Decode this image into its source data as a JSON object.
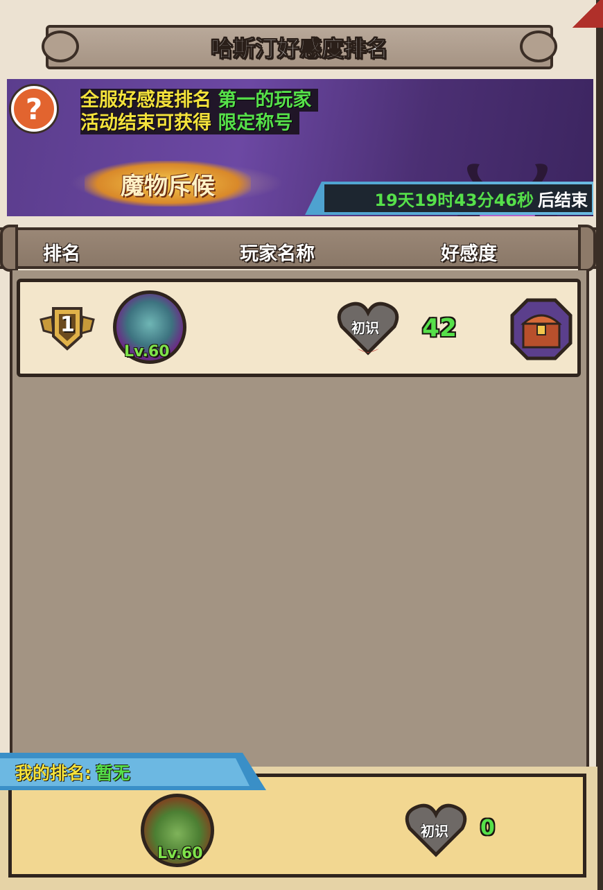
{
  "title": "哈斯汀好感度排名",
  "banner": {
    "help_icon": "question-mark",
    "line1_prefix": "全服好感度排名",
    "line1_highlight": "第一的玩家",
    "line2_prefix": "活动结束可获得",
    "line2_highlight": "限定称号",
    "event_logo": "魔物斥候",
    "countdown": "19天19时43分46秒",
    "countdown_suffix": "后结束"
  },
  "columns": {
    "rank": "排名",
    "player_name": "玩家名称",
    "favor": "好感度"
  },
  "rows": [
    {
      "rank": "1",
      "level": "Lv.60",
      "player_name": "",
      "relation": "初识",
      "favor": "42",
      "reward_icon": "treasure-chest"
    }
  ],
  "my_rank": {
    "label": "我的排名:",
    "value": "暂无",
    "level": "Lv.60",
    "relation": "初识",
    "favor": "0"
  },
  "colors": {
    "highlight_green": "#56e04a",
    "highlight_yellow": "#f4e23c",
    "panel_brown": "#a39483",
    "row_cream": "#f3e6cb",
    "my_panel": "#f2d791"
  }
}
